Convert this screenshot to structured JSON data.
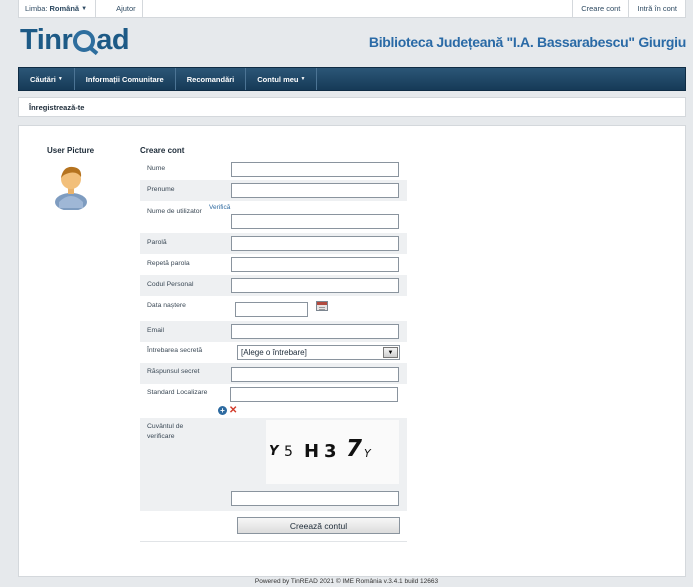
{
  "topbar": {
    "lang_label": "Limba:",
    "lang_value": "Română",
    "help": "Ajutor",
    "create_account": "Creare cont",
    "login": "Intră în cont"
  },
  "header": {
    "logo_left": "Tinr",
    "logo_right": "ad",
    "library_name": "Biblioteca Județeană \"I.A. Bassarabescu\" Giurgiu"
  },
  "nav": {
    "items": [
      {
        "label": "Căutări",
        "dropdown": true
      },
      {
        "label": "Informații Comunitare",
        "dropdown": false
      },
      {
        "label": "Recomandări",
        "dropdown": false
      },
      {
        "label": "Contul meu",
        "dropdown": true
      }
    ]
  },
  "breadcrumb": "Înregistrează-te",
  "user_picture_label": "User Picture",
  "form": {
    "title": "Creare cont",
    "nume": "Nume",
    "prenume": "Prenume",
    "username": "Nume de utilizator",
    "verify": "Verifică",
    "password": "Parolă",
    "repeat_password": "Repetă parola",
    "personal_code": "Codul Personal",
    "birth_date": "Data naștere",
    "email": "Email",
    "secret_question": "Întrebarea secretă",
    "secret_question_value": "[Alege o întrebare]",
    "secret_answer": "Răspunsul secret",
    "standard": "Standard Localizare",
    "verification_word": "Cuvântul de verificare",
    "captcha": [
      "Y",
      "5",
      "H",
      "3",
      "7",
      "Y"
    ],
    "submit": "Creează contul"
  },
  "footer": "Powered by TinREAD 2021 © IME România v.3.4.1 build 12663"
}
